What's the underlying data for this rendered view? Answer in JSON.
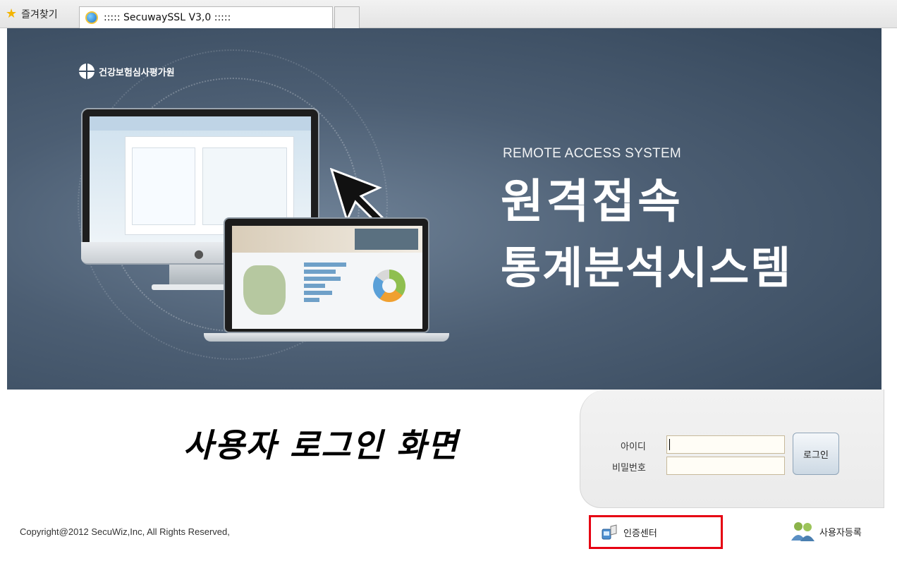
{
  "browser": {
    "favorites_label": "즐겨찾기",
    "tab_title": "::::: SecuwaySSL V3,0 :::::"
  },
  "hero": {
    "org_name": "건강보험심사평가원",
    "subtitle_en": "REMOTE ACCESS SYSTEM",
    "title_line1": "원격접속",
    "title_line2": "통계분석시스템"
  },
  "login": {
    "heading": "사용자 로그인 화면",
    "id_label": "아이디",
    "id_value": "",
    "password_label": "비밀번호",
    "password_value": "",
    "login_button": "로그인"
  },
  "footer": {
    "copyright": "Copyright@2012 SecuWiz,Inc, All Rights Reserved,",
    "cert_center": "인증센터",
    "user_register": "사용자등록"
  },
  "colors": {
    "highlight_box": "#e60012",
    "hero_bg": "#4c5e73"
  },
  "icons": [
    "star-icon",
    "ie-icon",
    "logo-icon",
    "apple-icon",
    "cursor-arrow-icon",
    "cert-center-icon",
    "users-icon"
  ]
}
